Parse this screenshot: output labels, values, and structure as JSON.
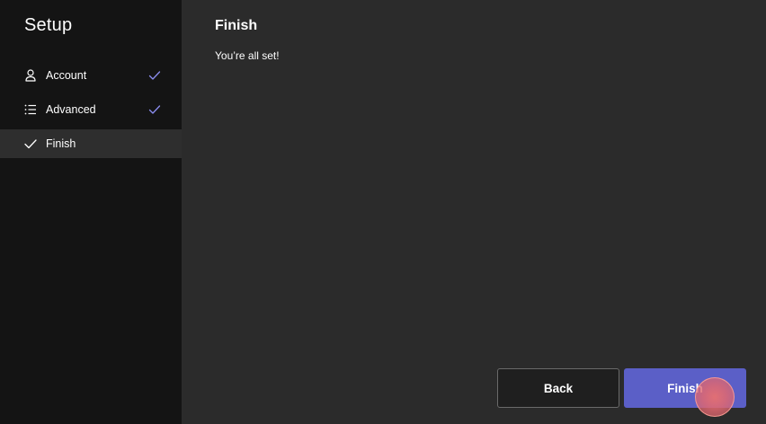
{
  "sidebar": {
    "title": "Setup",
    "items": [
      {
        "label": "Account",
        "icon": "person-icon",
        "completed": true,
        "active": false
      },
      {
        "label": "Advanced",
        "icon": "list-icon",
        "completed": true,
        "active": false
      },
      {
        "label": "Finish",
        "icon": "check-icon",
        "completed": false,
        "active": true
      }
    ]
  },
  "main": {
    "heading": "Finish",
    "message": "You’re all set!"
  },
  "footer": {
    "back_label": "Back",
    "finish_label": "Finish"
  },
  "colors": {
    "accent": "#5b5fc7",
    "check": "#8b8df0",
    "sidebar_bg": "#141414",
    "main_bg": "#2b2b2b"
  }
}
